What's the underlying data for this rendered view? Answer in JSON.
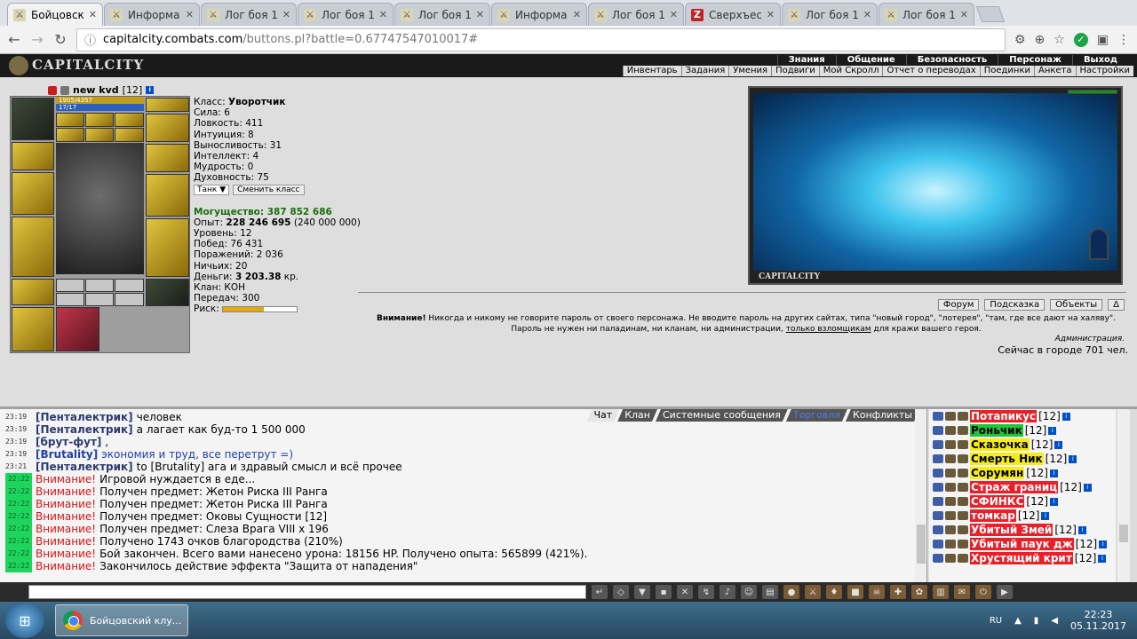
{
  "browser": {
    "tabs": [
      {
        "title": "Бойцовский клуб",
        "active": true,
        "icon": "fight-icon"
      },
      {
        "title": "Информация",
        "active": false,
        "icon": "fight-icon"
      },
      {
        "title": "Лог боя 1",
        "active": false,
        "icon": "fight-icon"
      },
      {
        "title": "Лог боя 1",
        "active": false,
        "icon": "fight-icon"
      },
      {
        "title": "Лог боя 1",
        "active": false,
        "icon": "fight-icon"
      },
      {
        "title": "Информация",
        "active": false,
        "icon": "fight-icon"
      },
      {
        "title": "Лог боя 1",
        "active": false,
        "icon": "fight-icon"
      },
      {
        "title": "Сверхъест",
        "active": false,
        "icon": "z-icon"
      },
      {
        "title": "Лог боя 1",
        "active": false,
        "icon": "fight-icon"
      },
      {
        "title": "Лог боя 1",
        "active": false,
        "icon": "fight-icon"
      }
    ],
    "url_host": "capitalcity.combats.com",
    "url_path": "/buttons.pl?battle=0.67747547010017#"
  },
  "game_nav": {
    "logo": "CAPITALCITY",
    "top": [
      "Знания",
      "Общение",
      "Безопасность",
      "Персонаж",
      "Выход"
    ],
    "bottom": [
      "Инвентарь",
      "Задания",
      "Умения",
      "Подвиги",
      "Мой Скролл",
      "Отчет о переводах",
      "Поединки",
      "Анкета",
      "Настройки"
    ]
  },
  "character": {
    "name": "new kvd",
    "level": "[12]",
    "hp": "1905/4357",
    "mana": "17/17",
    "class_label": "Класс:",
    "class_value": "Уворотчик",
    "stats": [
      {
        "label": "Сила:",
        "value": "6"
      },
      {
        "label": "Ловкость:",
        "value": "411"
      },
      {
        "label": "Интуиция:",
        "value": "8"
      },
      {
        "label": "Выносливость:",
        "value": "31"
      },
      {
        "label": "Интеллект:",
        "value": "4"
      },
      {
        "label": "Мудрость:",
        "value": "0"
      },
      {
        "label": "Духовность:",
        "value": "75"
      }
    ],
    "role_select": "Танк",
    "change_class": "Сменить класс",
    "power": "Могущество: 387 852 686",
    "exp_label": "Опыт:",
    "exp_value": "228 246 695",
    "exp_next": "(240 000 000)",
    "info": [
      {
        "label": "Уровень:",
        "value": "12"
      },
      {
        "label": "Побед:",
        "value": "76 431"
      },
      {
        "label": "Поражений:",
        "value": "2 036"
      },
      {
        "label": "Ничьих:",
        "value": "20"
      }
    ],
    "money_label": "Деньги:",
    "money_value": "3 203.38",
    "money_unit": "кр.",
    "clan_label": "Клан:",
    "clan_value": "КОН",
    "transfers_label": "Передач:",
    "transfers_value": "300",
    "risk_label": "Риск:",
    "risk_level": 0.55
  },
  "location": {
    "caption": "CAPITALCITY",
    "buttons": [
      "Форум",
      "Подсказка",
      "Объекты",
      "Δ"
    ],
    "warning_bold": "Внимание!",
    "warning_text": "Никогда и никому не говорите пароль от своего персонажа. Не вводите пароль на других сайтах, типа \"новый город\", \"лотерея\", \"там, где все дают на халяву\". Пароль не нужен ни паладинам, ни кланам, ни администрации,",
    "warning_link": "только взломщикам",
    "warning_tail": "для кражи вашего героя.",
    "admin": "Администрация.",
    "online": "Сейчас в городе 701 чел."
  },
  "chat": {
    "tabs": [
      "Чат",
      "Клан",
      "Системные сообщения",
      "Торговля",
      "Конфликты"
    ],
    "messages": [
      {
        "time": "23:19",
        "nick": "[Пенталектрик]",
        "text": "человек",
        "type": "user"
      },
      {
        "time": "23:19",
        "nick": "[Пенталектрик]",
        "text": "а лагает как буд-то 1 500 000",
        "type": "user"
      },
      {
        "time": "23:19",
        "nick": "[брут-фут]",
        "text": ",",
        "type": "user"
      },
      {
        "time": "23:19",
        "nick": "[Brutality]",
        "text": "экономия и труд, все перетрут =)",
        "type": "user_blue"
      },
      {
        "time": "23:21",
        "nick": "[Пенталектрик]",
        "text": "to [Brutality] ага и здравый смысл и всё прочее",
        "type": "user"
      },
      {
        "time": "22:22",
        "nick": "Внимание!",
        "text": "Игровой нуждается в еде...",
        "type": "sys"
      },
      {
        "time": "22:22",
        "nick": "Внимание!",
        "text": "Получен предмет: Жетон Риска III Ранга",
        "type": "sys"
      },
      {
        "time": "22:22",
        "nick": "Внимание!",
        "text": "Получен предмет: Жетон Риска III Ранга",
        "type": "sys"
      },
      {
        "time": "22:22",
        "nick": "Внимание!",
        "text": "Получен предмет: Оковы Сущности [12]",
        "type": "sys"
      },
      {
        "time": "22:22",
        "nick": "Внимание!",
        "text": "Получен предмет: Слеза Врага VIII x 196",
        "type": "sys"
      },
      {
        "time": "22:22",
        "nick": "Внимание!",
        "text": "Получено 1743 очков благородства (210%)",
        "type": "sys"
      },
      {
        "time": "22:22",
        "nick": "Внимание!",
        "text": "Бой закончен. Всего вами нанесено урона: 18156 HP. Получено опыта: 565899 (421%).",
        "type": "sys"
      },
      {
        "time": "22:22",
        "nick": "Внимание!",
        "text": "Закончилось действие эффекта \"Защита от нападения\"",
        "type": "sys"
      }
    ]
  },
  "users": [
    {
      "name": "Потапикус",
      "level": "[12]",
      "color": "#e8202a",
      "fg": "#fff"
    },
    {
      "name": "Роньчик",
      "level": "[12]",
      "color": "#1fc43a",
      "fg": "#000"
    },
    {
      "name": "Сказочка",
      "level": "[12]",
      "color": "#f5ec1a",
      "fg": "#000"
    },
    {
      "name": "Смерть Ник",
      "level": "[12]",
      "color": "#f5ec1a",
      "fg": "#000"
    },
    {
      "name": "Сорумян",
      "level": "[12]",
      "color": "#f5ec1a",
      "fg": "#000"
    },
    {
      "name": "Страж границ",
      "level": "[12]",
      "color": "#e8202a",
      "fg": "#fff"
    },
    {
      "name": "СФИНКС",
      "level": "[12]",
      "color": "#e8202a",
      "fg": "#fff"
    },
    {
      "name": "томкар",
      "level": "[12]",
      "color": "#e8202a",
      "fg": "#fff"
    },
    {
      "name": "Убитый Змей",
      "level": "[12]",
      "color": "#e8202a",
      "fg": "#fff"
    },
    {
      "name": "Убитый паук дж",
      "level": "[12]",
      "color": "#e8202a",
      "fg": "#fff"
    },
    {
      "name": "Хрустящий крит",
      "level": "[12]",
      "color": "#e8202a",
      "fg": "#fff"
    }
  ],
  "taskbar": {
    "task_label": "Бойцовский клу...",
    "lang": "RU",
    "time": "22:23",
    "date": "05.11.2017"
  }
}
